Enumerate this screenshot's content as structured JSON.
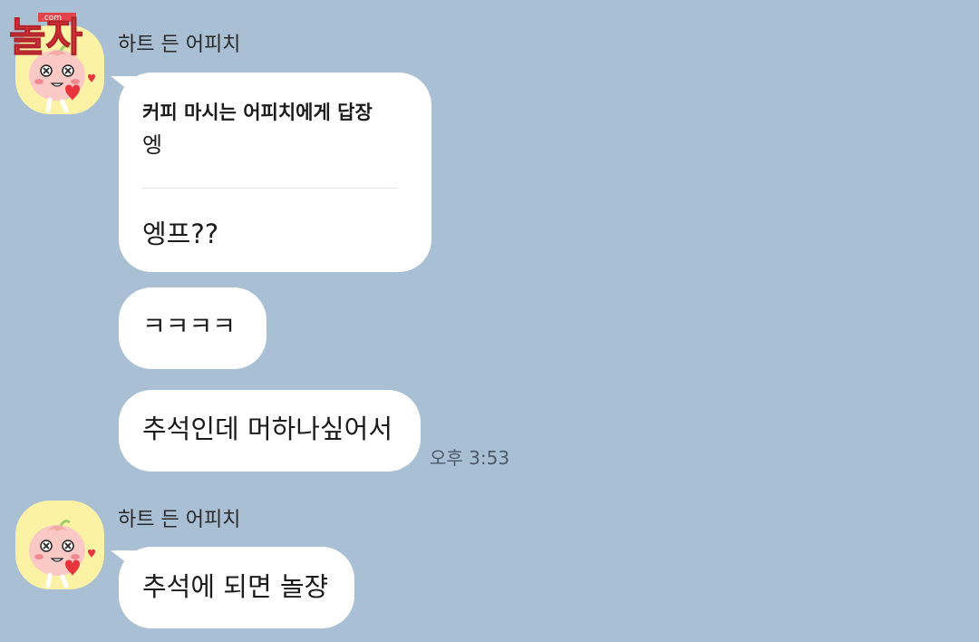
{
  "watermark": {
    "text": "놀자",
    "sub": ".com"
  },
  "messages": [
    {
      "sender": "하트 든 어피치",
      "reply": {
        "target": "커피 마시는 어피치에게 답장",
        "quote": "엥",
        "text": "엥프??"
      },
      "bubbles": [
        "ㅋㅋㅋㅋ",
        "추석인데 머하나싶어서"
      ],
      "time": "오후 3:53"
    },
    {
      "sender": "하트 든 어피치",
      "bubbles": [
        "추석에 되면 놀쟝"
      ]
    }
  ],
  "colors": {
    "background": "#a9bfd3",
    "bubble": "#ffffff",
    "avatar_bg": "#fbf2a6",
    "watermark": "#e8353d"
  },
  "icons": {
    "avatar": "apeach-holding-heart-icon"
  }
}
